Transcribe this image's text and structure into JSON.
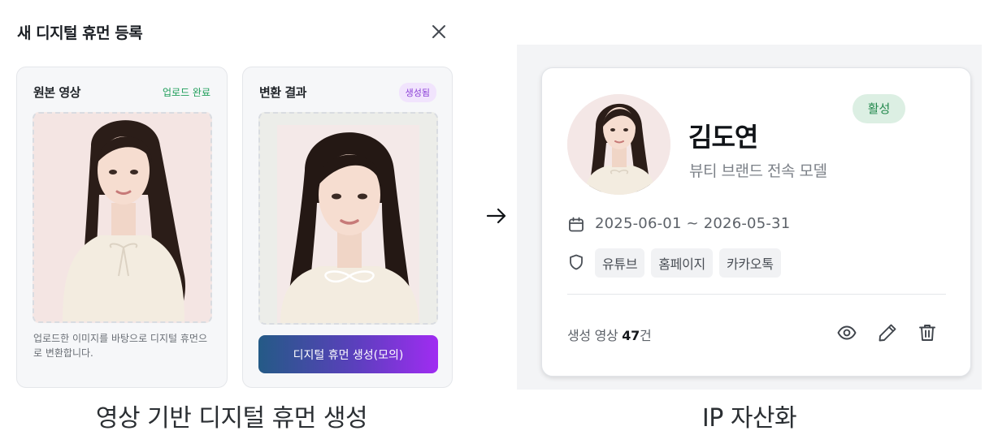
{
  "modal": {
    "title": "새 디지털 휴먼 등록",
    "close_icon": "close-icon"
  },
  "source_panel": {
    "title": "원본 영상",
    "status": "업로드 완료",
    "description": "업로드한 이미지를 바탕으로 디지털 휴먼으로 변환합니다."
  },
  "result_panel": {
    "title": "변환 결과",
    "badge": "생성됨",
    "button_label": "디지털 휴먼 생성(모의)"
  },
  "captions": {
    "left": "영상 기반 디지털 휴먼 생성",
    "right": "IP 자산화"
  },
  "profile_card": {
    "name": "김도연",
    "role": "뷰티 브랜드 전속 모델",
    "status": "활성",
    "date_range": "2025-06-01 ~ 2026-05-31",
    "channels": [
      "유튜브",
      "홈페이지",
      "카카오톡"
    ],
    "video_count_label": "생성 영상",
    "video_count_value": "47",
    "video_count_unit": "건",
    "icons": [
      "calendar-icon",
      "shield-icon",
      "eye-icon",
      "pencil-icon",
      "trash-icon"
    ]
  },
  "colors": {
    "accent_gradient_start": "#245a86",
    "accent_gradient_end": "#a02cf2",
    "success_green": "#1e9e5a",
    "badge_purple": "#8b3fd6"
  }
}
